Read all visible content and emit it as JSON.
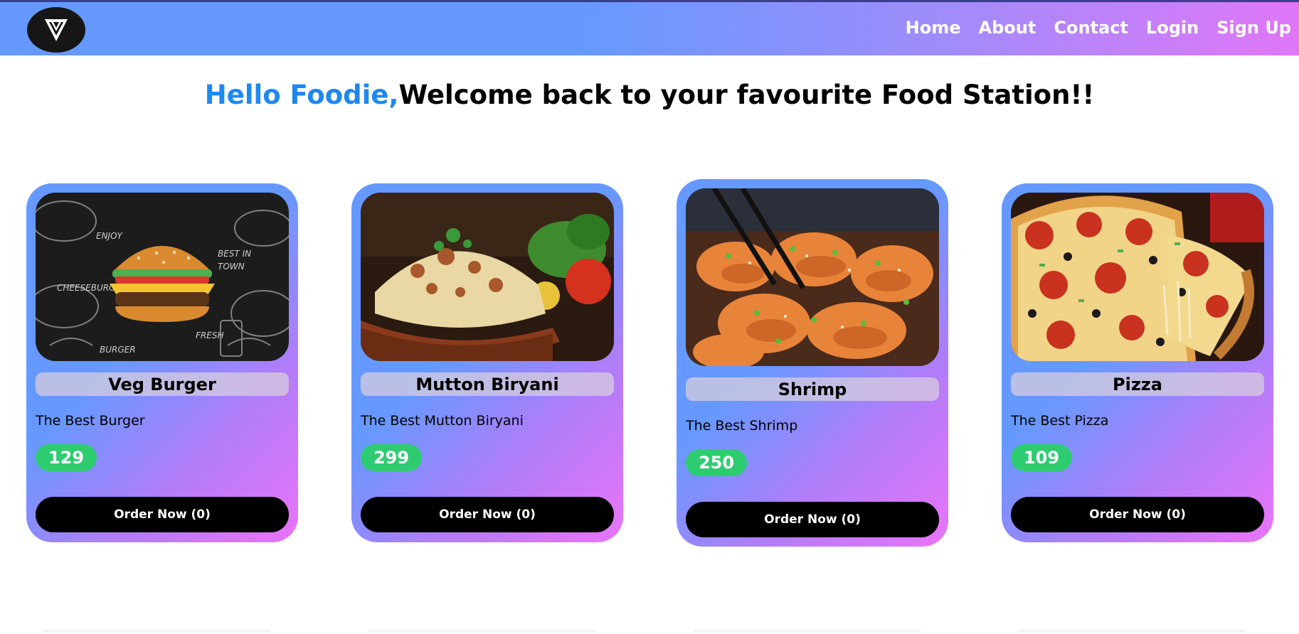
{
  "navbar": {
    "logo_icon": "v-logo-icon",
    "links": [
      "Home",
      "About",
      "Contact",
      "Login",
      "Sign Up"
    ],
    "gradient": [
      "#6699ff",
      "#e077f8"
    ]
  },
  "hero": {
    "greeting": "Hello Foodie,",
    "message": "Welcome back to your favourite Food Station!!",
    "greeting_color": "#1e88f0"
  },
  "cards": [
    {
      "name": "Veg Burger",
      "description": "The Best Burger",
      "price": "129",
      "order_label": "Order Now (0)",
      "image_icon": "burger-image"
    },
    {
      "name": "Mutton Biryani",
      "description": "The Best Mutton Biryani",
      "price": "299",
      "order_label": "Order Now (0)",
      "image_icon": "biryani-image"
    },
    {
      "name": "Shrimp",
      "description": "The Best Shrimp",
      "price": "250",
      "order_label": "Order Now (0)",
      "image_icon": "shrimp-image"
    },
    {
      "name": "Pizza",
      "description": "The Best Pizza",
      "price": "109",
      "order_label": "Order Now (0)",
      "image_icon": "pizza-image"
    }
  ],
  "colors": {
    "price_badge": "#2ecc71",
    "order_button": "#000000",
    "card_gradient_start": "#6699ff",
    "card_gradient_end": "#ea74f7"
  }
}
